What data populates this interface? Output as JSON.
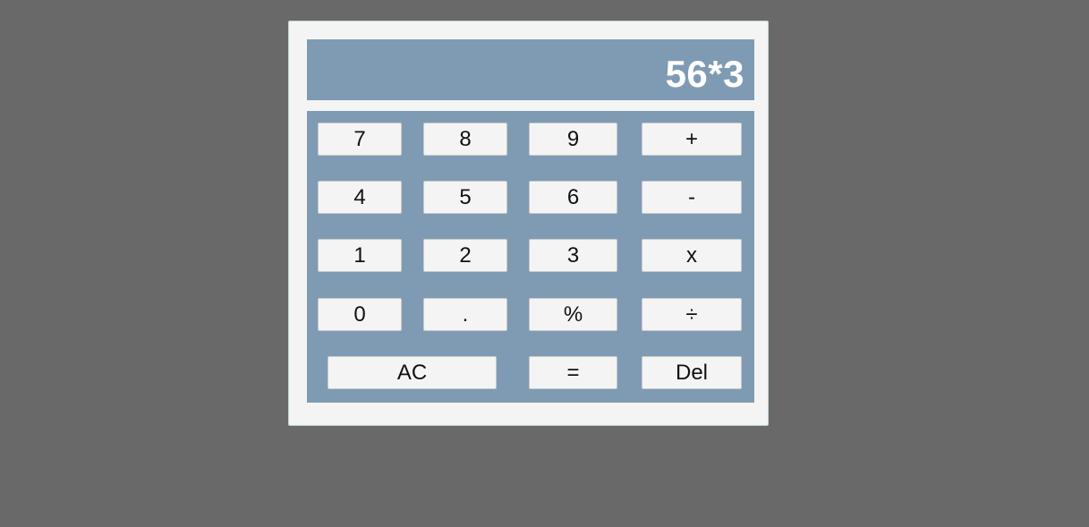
{
  "display": {
    "expression": "56*3"
  },
  "buttons": {
    "seven": "7",
    "eight": "8",
    "nine": "9",
    "plus": "+",
    "four": "4",
    "five": "5",
    "six": "6",
    "minus": "-",
    "one": "1",
    "two": "2",
    "three": "3",
    "multiply": "x",
    "zero": "0",
    "decimal": ".",
    "percent": "%",
    "divide": "÷",
    "clear": "AC",
    "equals": "=",
    "delete": "Del"
  },
  "colors": {
    "page_background": "#696969",
    "panel_background": "#f4f4f4",
    "accent": "#7f9bb3",
    "display_text": "#ffffff"
  }
}
